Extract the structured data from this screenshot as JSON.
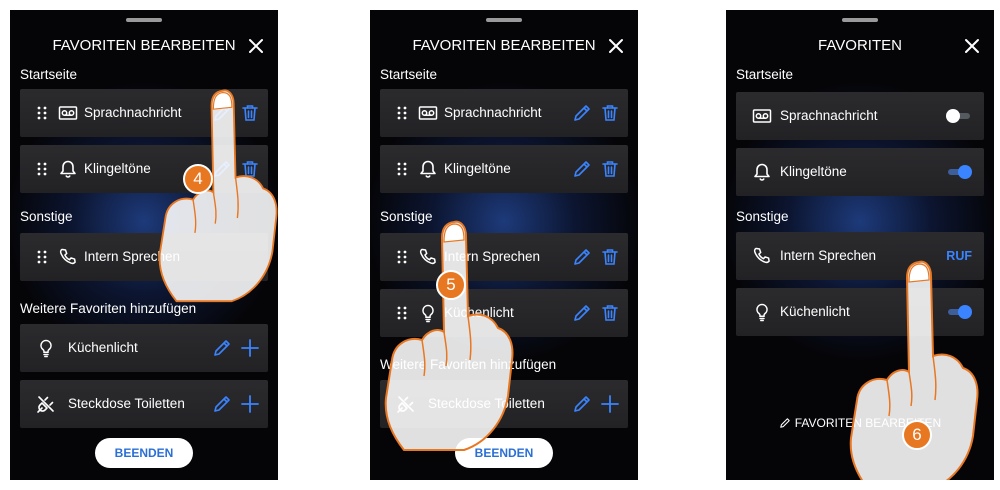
{
  "colors": {
    "accent": "#3a84ff",
    "step_badge": "#e87722",
    "card_bg": "#262628"
  },
  "screen1": {
    "title": "FAVORITEN BEARBEITEN",
    "section_home": "Startseite",
    "section_other": "Sonstige",
    "section_add": "Weitere Favoriten hinzufügen",
    "items": {
      "voicemail": "Sprachnachricht",
      "ringtones": "Klingeltöne",
      "intercom": "Intern Sprechen",
      "kitchen_light": "Küchenlicht",
      "socket": "Steckdose Toiletten"
    },
    "finish_button": "BEENDEN",
    "step": "4"
  },
  "screen2": {
    "title": "FAVORITEN BEARBEITEN",
    "section_home": "Startseite",
    "section_other": "Sonstige",
    "section_add": "Weitere Favoriten hinzufügen",
    "items": {
      "voicemail": "Sprachnachricht",
      "ringtones": "Klingeltöne",
      "intercom": "Intern Sprechen",
      "kitchen_light": "Küchenlicht",
      "socket": "Steckdose Toiletten"
    },
    "finish_button": "BEENDEN",
    "step": "5"
  },
  "screen3": {
    "title": "FAVORITEN",
    "section_home": "Startseite",
    "section_other": "Sonstige",
    "items": {
      "voicemail": "Sprachnachricht",
      "ringtones": "Klingeltöne",
      "intercom": "Intern Sprechen",
      "kitchen_light": "Küchenlicht"
    },
    "call_label": "RUF",
    "edit_link": "FAVORITEN BEARBEITEN",
    "step": "6"
  }
}
